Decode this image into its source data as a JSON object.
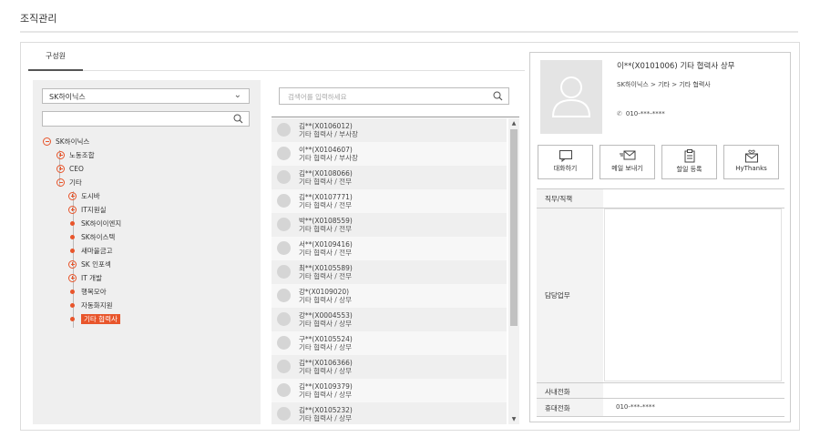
{
  "page": {
    "title": "조직관리"
  },
  "tabs": [
    {
      "label": "구성원",
      "active": true
    }
  ],
  "tree": {
    "company_select": {
      "value": "SK하이닉스"
    },
    "search": {
      "value": ""
    },
    "nodes": [
      {
        "label": "SK하이닉스",
        "level": 0,
        "type": "expanded"
      },
      {
        "label": "노동조합",
        "level": 1,
        "type": "collapsed"
      },
      {
        "label": "CEO",
        "level": 1,
        "type": "collapsed"
      },
      {
        "label": "기타",
        "level": 1,
        "type": "expanded"
      },
      {
        "label": "도시바",
        "level": 2,
        "type": "collapsed"
      },
      {
        "label": "IT지원실",
        "level": 2,
        "type": "collapsed"
      },
      {
        "label": "SK하이이엔지",
        "level": 2,
        "type": "leaf"
      },
      {
        "label": "SK하이스텍",
        "level": 2,
        "type": "leaf"
      },
      {
        "label": "새마을금고",
        "level": 2,
        "type": "leaf"
      },
      {
        "label": "SK 인포섹",
        "level": 2,
        "type": "collapsed"
      },
      {
        "label": "IT 개발",
        "level": 2,
        "type": "collapsed"
      },
      {
        "label": "행복모아",
        "level": 2,
        "type": "leaf"
      },
      {
        "label": "자동화지원",
        "level": 2,
        "type": "leaf"
      },
      {
        "label": "기타 협력사",
        "level": 2,
        "type": "leaf",
        "selected": true
      }
    ]
  },
  "member_search": {
    "placeholder": "검색어를 입력하세요"
  },
  "members": [
    {
      "name": "김**(X0106012)",
      "role": "기타 협력사 / 부사장"
    },
    {
      "name": "이**(X0104607)",
      "role": "기타 협력사 / 부사장"
    },
    {
      "name": "김**(X0108066)",
      "role": "기타 협력사 / 전무"
    },
    {
      "name": "김**(X0107771)",
      "role": "기타 협력사 / 전무"
    },
    {
      "name": "박**(X0108559)",
      "role": "기타 협력사 / 전무"
    },
    {
      "name": "서**(X0109416)",
      "role": "기타 협력사 / 전무"
    },
    {
      "name": "최**(X0105589)",
      "role": "기타 협력사 / 전무"
    },
    {
      "name": "강*(X0109020)",
      "role": "기타 협력사 / 상무"
    },
    {
      "name": "강**(X0004553)",
      "role": "기타 협력사 / 상무"
    },
    {
      "name": "구**(X0105524)",
      "role": "기타 협력사 / 상무"
    },
    {
      "name": "김**(X0106366)",
      "role": "기타 협력사 / 상무"
    },
    {
      "name": "김**(X0109379)",
      "role": "기타 협력사 / 상무"
    },
    {
      "name": "김**(X0105232)",
      "role": "기타 협력사 / 상무"
    }
  ],
  "profile": {
    "name": "이**(X0101006) 기타 협력사 상무",
    "path": "SK하이닉스 > 기타 > 기타 협력사",
    "phone": "010-***-****",
    "actions": [
      {
        "label": "대화하기",
        "icon": "chat-icon"
      },
      {
        "label": "메일 보내기",
        "icon": "mail-icon"
      },
      {
        "label": "할일 등록",
        "icon": "clipboard-icon"
      },
      {
        "label": "HyThanks",
        "icon": "heart-envelope-icon"
      }
    ],
    "fields": {
      "title_label": "직무/직책",
      "title_value": "",
      "duty_label": "담당업무",
      "duty_value": "",
      "office_phone_label": "사내전화",
      "office_phone_value": "",
      "mobile_label": "휴대전화",
      "mobile_value": "010-***-****"
    }
  },
  "colors": {
    "accent": "#e8552b",
    "panel_bg": "#efefef",
    "border": "#cccccc"
  }
}
